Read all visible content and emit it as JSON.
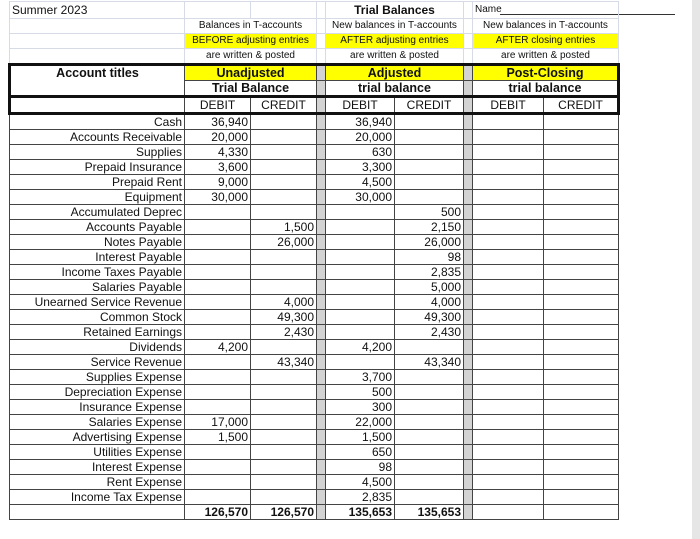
{
  "header": {
    "term": "Summer 2023",
    "title": "Trial Balances",
    "name_label": "Name",
    "unadjusted": {
      "line1": "Balances in T-accounts",
      "line2": "BEFORE adjusting entries",
      "line3": "are written & posted",
      "title1": "Unadjusted",
      "title2": "Trial Balance"
    },
    "adjusted": {
      "line1": "New balances in T-accounts",
      "line2": "AFTER adjusting entries",
      "line3": "are written & posted",
      "title1": "Adjusted",
      "title2": "trial balance"
    },
    "postclosing": {
      "line1": "New balances in T-accounts",
      "line2": "AFTER closing entries",
      "line3": "are written & posted",
      "title1": "Post-Closing",
      "title2": "trial balance"
    },
    "account_titles": "Account titles",
    "debit": "DEBIT",
    "credit": "CREDIT"
  },
  "colors": {
    "highlight": "#ffff00",
    "separator": "#d3d3d3"
  },
  "rows": [
    {
      "label": "Cash",
      "v": [
        "36,940",
        "",
        "36,940",
        "",
        "",
        ""
      ]
    },
    {
      "label": "Accounts Receivable",
      "v": [
        "20,000",
        "",
        "20,000",
        "",
        "",
        ""
      ]
    },
    {
      "label": "Supplies",
      "v": [
        "4,330",
        "",
        "630",
        "",
        "",
        ""
      ]
    },
    {
      "label": "Prepaid Insurance",
      "v": [
        "3,600",
        "",
        "3,300",
        "",
        "",
        ""
      ]
    },
    {
      "label": "Prepaid Rent",
      "v": [
        "9,000",
        "",
        "4,500",
        "",
        "",
        ""
      ]
    },
    {
      "label": "Equipment",
      "v": [
        "30,000",
        "",
        "30,000",
        "",
        "",
        ""
      ]
    },
    {
      "label": "Accumulated Deprec",
      "v": [
        "",
        "",
        "",
        "500",
        "",
        ""
      ]
    },
    {
      "label": "Accounts Payable",
      "v": [
        "",
        "1,500",
        "",
        "2,150",
        "",
        ""
      ]
    },
    {
      "label": "Notes Payable",
      "v": [
        "",
        "26,000",
        "",
        "26,000",
        "",
        ""
      ]
    },
    {
      "label": "Interest Payable",
      "v": [
        "",
        "",
        "",
        "98",
        "",
        ""
      ]
    },
    {
      "label": "Income Taxes Payable",
      "v": [
        "",
        "",
        "",
        "2,835",
        "",
        ""
      ]
    },
    {
      "label": "Salaries Payable",
      "v": [
        "",
        "",
        "",
        "5,000",
        "",
        ""
      ]
    },
    {
      "label": "Unearned Service Revenue",
      "v": [
        "",
        "4,000",
        "",
        "4,000",
        "",
        ""
      ]
    },
    {
      "label": "Common Stock",
      "v": [
        "",
        "49,300",
        "",
        "49,300",
        "",
        ""
      ]
    },
    {
      "label": "Retained Earnings",
      "v": [
        "",
        "2,430",
        "",
        "2,430",
        "",
        ""
      ]
    },
    {
      "label": "Dividends",
      "v": [
        "4,200",
        "",
        "4,200",
        "",
        "",
        ""
      ]
    },
    {
      "label": "Service Revenue",
      "v": [
        "",
        "43,340",
        "",
        "43,340",
        "",
        ""
      ]
    },
    {
      "label": "Supplies Expense",
      "v": [
        "",
        "",
        "3,700",
        "",
        "",
        ""
      ]
    },
    {
      "label": "Depreciation Expense",
      "v": [
        "",
        "",
        "500",
        "",
        "",
        ""
      ]
    },
    {
      "label": "Insurance Expense",
      "v": [
        "",
        "",
        "300",
        "",
        "",
        ""
      ]
    },
    {
      "label": "Salaries Expense",
      "v": [
        "17,000",
        "",
        "22,000",
        "",
        "",
        ""
      ]
    },
    {
      "label": "Advertising Expense",
      "v": [
        "1,500",
        "",
        "1,500",
        "",
        "",
        ""
      ]
    },
    {
      "label": "Utilities Expense",
      "v": [
        "",
        "",
        "650",
        "",
        "",
        ""
      ]
    },
    {
      "label": "Interest Expense",
      "v": [
        "",
        "",
        "98",
        "",
        "",
        ""
      ]
    },
    {
      "label": "Rent Expense",
      "v": [
        "",
        "",
        "4,500",
        "",
        "",
        ""
      ]
    },
    {
      "label": "Income Tax Expense",
      "v": [
        "",
        "",
        "2,835",
        "",
        "",
        ""
      ]
    }
  ],
  "totals": [
    "126,570",
    "126,570",
    "135,653",
    "135,653",
    "",
    ""
  ]
}
